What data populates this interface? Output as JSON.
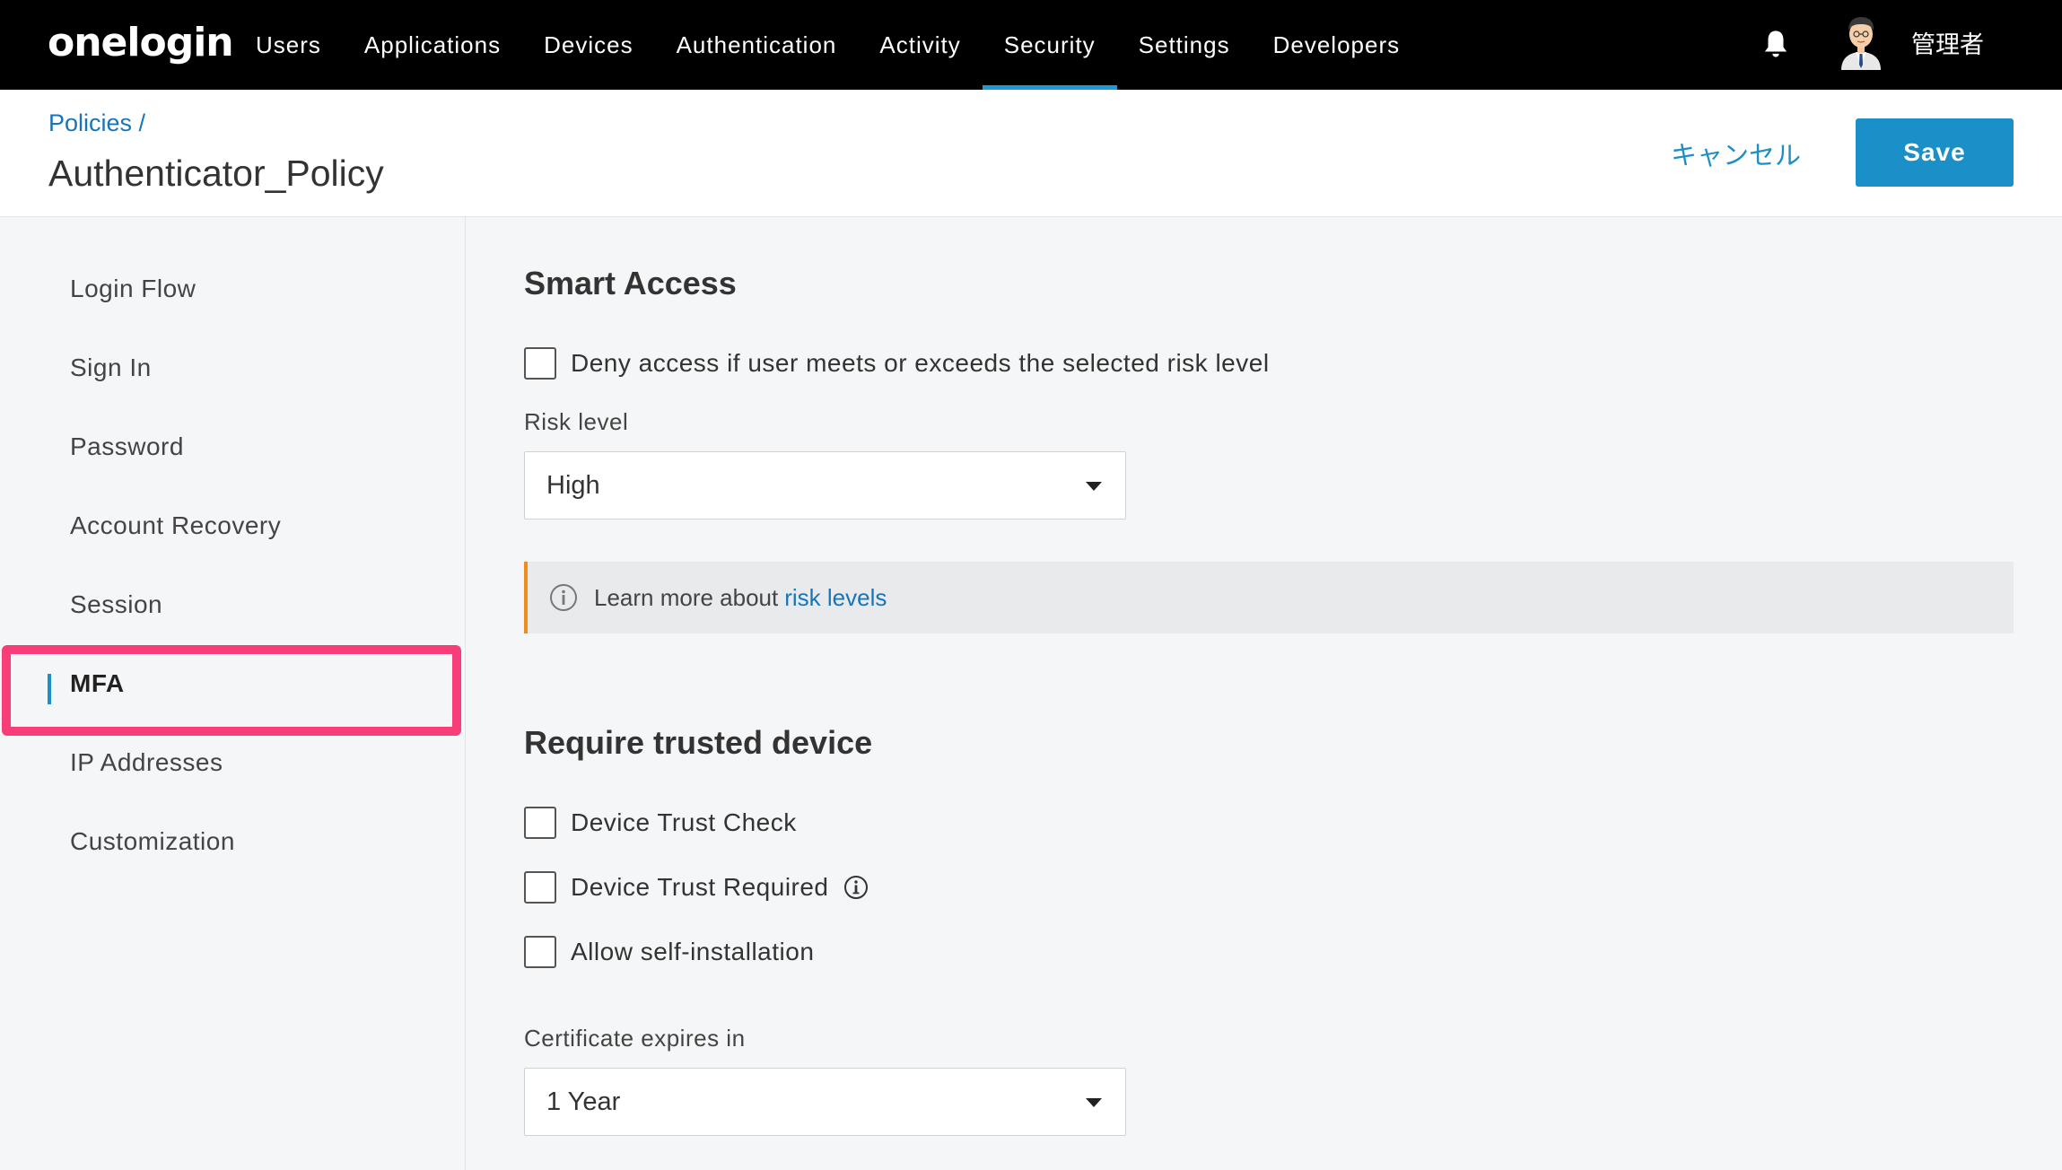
{
  "nav": {
    "logo": "onelogin",
    "items": [
      {
        "label": "Users"
      },
      {
        "label": "Applications"
      },
      {
        "label": "Devices"
      },
      {
        "label": "Authentication"
      },
      {
        "label": "Activity"
      },
      {
        "label": "Security",
        "active": true
      },
      {
        "label": "Settings"
      },
      {
        "label": "Developers"
      }
    ],
    "user_name": "管理者",
    "icons": [
      "bell-icon",
      "avatar"
    ]
  },
  "header": {
    "breadcrumb": "Policies /",
    "title": "Authenticator_Policy",
    "cancel_label": "キャンセル",
    "save_label": "Save"
  },
  "sidebar": {
    "items": [
      {
        "label": "Login Flow"
      },
      {
        "label": "Sign In"
      },
      {
        "label": "Password"
      },
      {
        "label": "Account Recovery"
      },
      {
        "label": "Session"
      },
      {
        "label": "MFA",
        "active": true
      },
      {
        "label": "IP Addresses"
      },
      {
        "label": "Customization"
      }
    ]
  },
  "smart_access": {
    "title": "Smart Access",
    "deny_checkbox_label": "Deny access if user meets or exceeds the selected risk level",
    "deny_checked": false,
    "risk_level_label": "Risk level",
    "risk_level_value": "High",
    "info_text": "Learn more about",
    "info_link": "risk levels"
  },
  "trusted_device": {
    "title": "Require trusted device",
    "checkboxes": [
      {
        "label": "Device Trust Check",
        "checked": false
      },
      {
        "label": "Device Trust Required",
        "checked": false
      },
      {
        "label": "Allow self-installation",
        "checked": false
      }
    ],
    "cert_label": "Certificate expires in",
    "cert_value": "1 Year"
  },
  "colors": {
    "nav_bg": "#000000",
    "accent": "#1b90c8",
    "link": "#1775b8",
    "highlight": "#f73e79",
    "info_border": "#f08c1e"
  }
}
